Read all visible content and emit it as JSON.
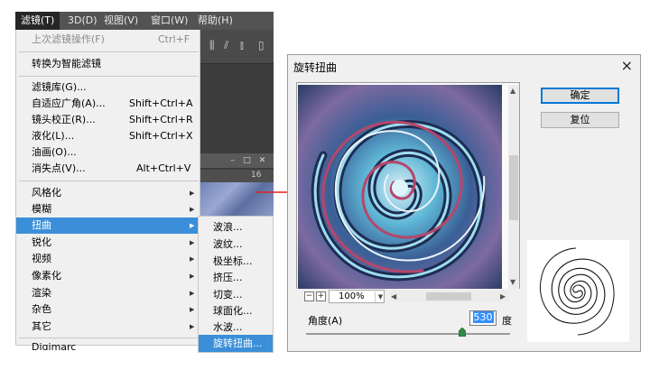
{
  "menubar": {
    "items": [
      {
        "label": "滤镜(T)",
        "active": true
      },
      {
        "label": "3D(D)"
      },
      {
        "label": "视图(V)"
      },
      {
        "label": "窗口(W)"
      },
      {
        "label": "帮助(H)"
      }
    ]
  },
  "ruler": {
    "label": "16"
  },
  "filter_menu": {
    "last_filter": {
      "label": "上次滤镜操作(F)",
      "shortcut": "Ctrl+F"
    },
    "convert_smart": "转换为智能滤镜",
    "gallery": "滤镜库(G)...",
    "adaptive_wide": {
      "label": "自适应广角(A)...",
      "shortcut": "Shift+Ctrl+A"
    },
    "lens_correction": {
      "label": "镜头校正(R)...",
      "shortcut": "Shift+Ctrl+R"
    },
    "liquify": {
      "label": "液化(L)...",
      "shortcut": "Shift+Ctrl+X"
    },
    "oil_paint": "油画(O)...",
    "vanishing_point": {
      "label": "消失点(V)...",
      "shortcut": "Alt+Ctrl+V"
    },
    "stylize": "风格化",
    "blur": "模糊",
    "distort": "扭曲",
    "sharpen": "锐化",
    "video": "视频",
    "pixelate": "像素化",
    "render": "渲染",
    "noise": "杂色",
    "other": "其它",
    "digimarc": "Digimarc"
  },
  "distort_submenu": {
    "items": [
      "波浪...",
      "波纹...",
      "极坐标...",
      "挤压...",
      "切变...",
      "球面化...",
      "水波...",
      "旋转扭曲..."
    ]
  },
  "dialog": {
    "title": "旋转扭曲",
    "ok": "确定",
    "reset": "复位",
    "zoom": "100%",
    "zoom_out": "−",
    "zoom_in": "+",
    "angle_label": "角度(A)",
    "angle_value": "530",
    "angle_unit": "度",
    "angle_range": [
      -999,
      999
    ],
    "close": "×"
  },
  "colors": {
    "highlight": "#3b8fd8",
    "arrow": "#e02020",
    "menubar": "#535353"
  }
}
